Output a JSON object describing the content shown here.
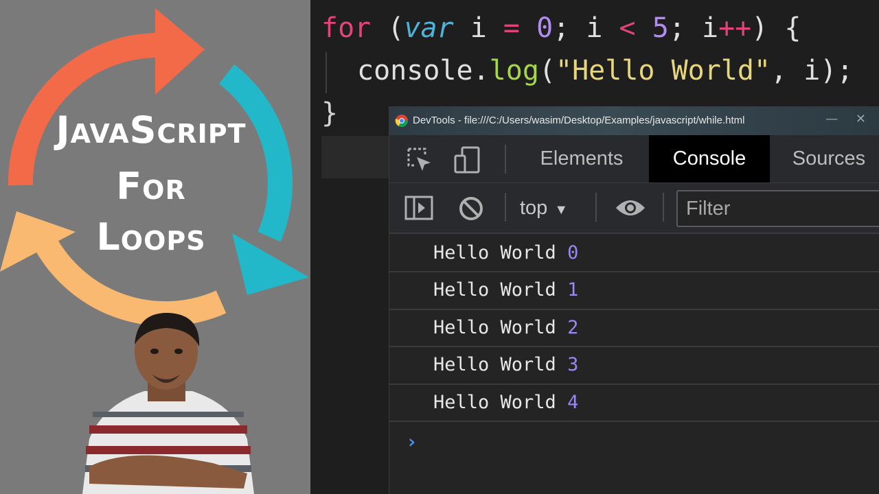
{
  "thumbnail": {
    "title_lines": [
      "JavaScript",
      "For",
      "Loops"
    ],
    "colors": {
      "background": "#7a7a7a",
      "arrow_orange": "#f26a47",
      "arrow_teal": "#23b8c9",
      "arrow_yellow": "#f9b970"
    },
    "icons": [
      "cycle-arrows-icon",
      "presenter-photo"
    ]
  },
  "editor": {
    "line1": {
      "kw": "for",
      "p1": " (",
      "kw2": "var",
      "p2": " i ",
      "op1": "=",
      "p3": " ",
      "n0": "0",
      "p4": "; i ",
      "op2": "<",
      "p5": " ",
      "n5": "5",
      "p6": "; i",
      "op3": "++",
      "p7": ") {"
    },
    "line2": {
      "obj": "console.",
      "fn": "log",
      "p1": "(",
      "str": "\"Hello World\"",
      "p2": ", i);"
    },
    "line3": "}"
  },
  "devtools": {
    "window_title": "DevTools - file:///C:/Users/wasim/Desktop/Examples/javascript/while.html",
    "tabs": [
      "Elements",
      "Console",
      "Sources"
    ],
    "active_tab": "Console",
    "context": "top",
    "context_arrow": "▼",
    "filter_placeholder": "Filter",
    "window_controls": "— ✕",
    "log_rows": [
      {
        "text": "Hello World ",
        "value": "0"
      },
      {
        "text": "Hello World ",
        "value": "1"
      },
      {
        "text": "Hello World ",
        "value": "2"
      },
      {
        "text": "Hello World ",
        "value": "3"
      },
      {
        "text": "Hello World ",
        "value": "4"
      }
    ],
    "prompt_symbol": "›",
    "colors": {
      "accent_prompt": "#4a8ff0",
      "log_number": "#9b87f5",
      "active_tab_bg": "#000000"
    }
  }
}
